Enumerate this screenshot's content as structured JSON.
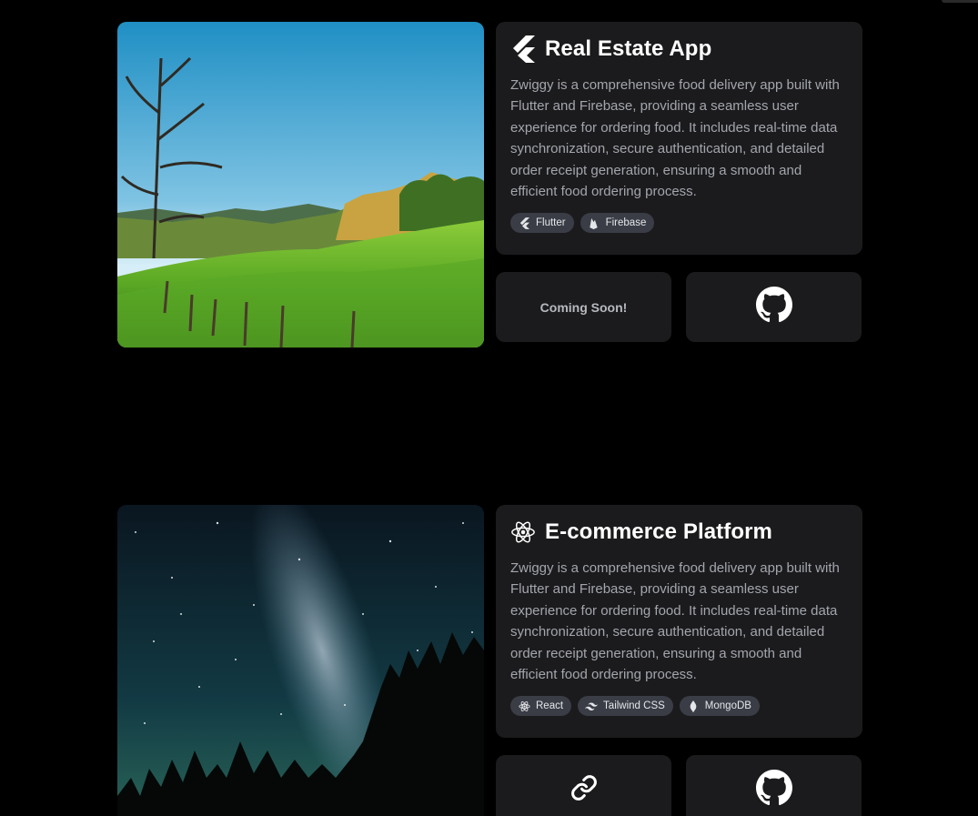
{
  "projects": [
    {
      "title": "Real Estate App",
      "title_icon": "flutter-icon",
      "description": "Zwiggy is a comprehensive food delivery app built with Flutter and Firebase, providing a seamless user experience for ordering food. It includes real-time data synchronization, secure authentication, and detailed order receipt generation, ensuring a smooth and efficient food ordering process.",
      "tags": [
        {
          "label": "Flutter",
          "icon": "flutter-icon"
        },
        {
          "label": "Firebase",
          "icon": "firebase-icon"
        }
      ],
      "live_label": "Coming Soon!",
      "image": "meadow-landscape-photo",
      "github_icon": "github-icon"
    },
    {
      "title": "E-commerce Platform",
      "title_icon": "react-icon",
      "description": "Zwiggy is a comprehensive food delivery app built with Flutter and Firebase, providing a seamless user experience for ordering food. It includes real-time data synchronization, secure authentication, and detailed order receipt generation, ensuring a smooth and efficient food ordering process.",
      "tags": [
        {
          "label": "React",
          "icon": "react-icon"
        },
        {
          "label": "Tailwind CSS",
          "icon": "tailwind-icon"
        },
        {
          "label": "MongoDB",
          "icon": "mongodb-icon"
        }
      ],
      "live_icon": "link-icon",
      "image": "milky-way-night-sky-photo",
      "github_icon": "github-icon"
    }
  ],
  "colors": {
    "background": "#000000",
    "card": "#1b1b1d",
    "tag": "#3a3d46",
    "muted_text": "#a3a6ad"
  }
}
